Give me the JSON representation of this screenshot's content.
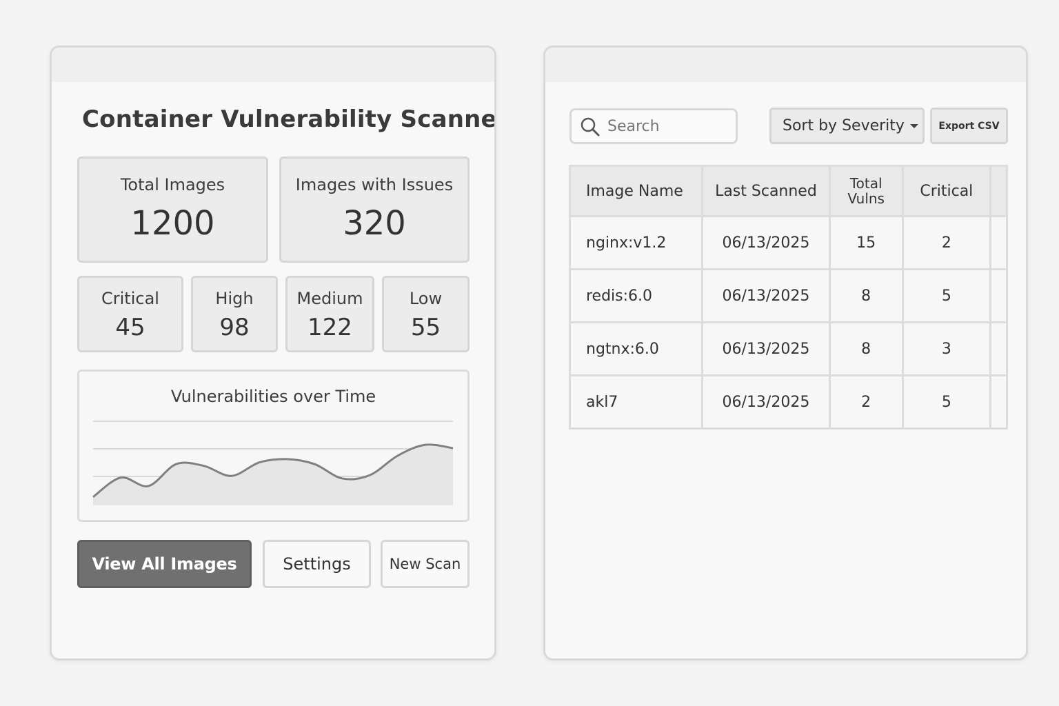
{
  "app": {
    "title": "Container Vulnerability Scanner"
  },
  "summary": {
    "total_images": {
      "label": "Total Images",
      "value": "1200"
    },
    "images_with_issues": {
      "label": "Images with Issues",
      "value": "320"
    }
  },
  "severity": [
    {
      "label": "Critical",
      "value": "45"
    },
    {
      "label": "High",
      "value": "98"
    },
    {
      "label": "Medium",
      "value": "122"
    },
    {
      "label": "Low",
      "value": "55"
    }
  ],
  "chart_data": {
    "type": "area",
    "title": "Vulnerabilities over Time",
    "xlabel": "",
    "ylabel": "",
    "grid": true,
    "legend": "none",
    "color": "#808080",
    "fill": "#e6e6e6",
    "ylim": [
      0,
      100
    ],
    "x": [
      0,
      1,
      2,
      3,
      4,
      5,
      6,
      7,
      8,
      9,
      10,
      11,
      12,
      13
    ],
    "values": [
      10,
      33,
      23,
      49,
      47,
      35,
      51,
      55,
      49,
      32,
      36,
      59,
      72,
      68
    ]
  },
  "buttons": {
    "view_all": "View All Images",
    "settings": "Settings",
    "new_scan": "New Scan"
  },
  "toolbar": {
    "search_placeholder": "Search",
    "sort_label": "Sort by Severity",
    "export_label": "Export CSV"
  },
  "table": {
    "headers": {
      "image_name": "Image Name",
      "last_scanned": "Last Scanned",
      "total_vulns_1": "Total",
      "total_vulns_2": "Vulns",
      "critical": "Critical"
    },
    "rows": [
      {
        "image": "nginx:v1.2",
        "scanned": "06/13/2025",
        "total": "15",
        "critical": "2"
      },
      {
        "image": "redis:6.0",
        "scanned": "06/13/2025",
        "total": "8",
        "critical": "5"
      },
      {
        "image": "ngtnx:6.0",
        "scanned": "06/13/2025",
        "total": "8",
        "critical": "3"
      },
      {
        "image": "akl7",
        "scanned": "06/13/2025",
        "total": "2",
        "critical": "5"
      }
    ]
  },
  "colors": {
    "primary_button": "#707070",
    "card_bg": "#ececec",
    "border": "#d6d6d6"
  }
}
